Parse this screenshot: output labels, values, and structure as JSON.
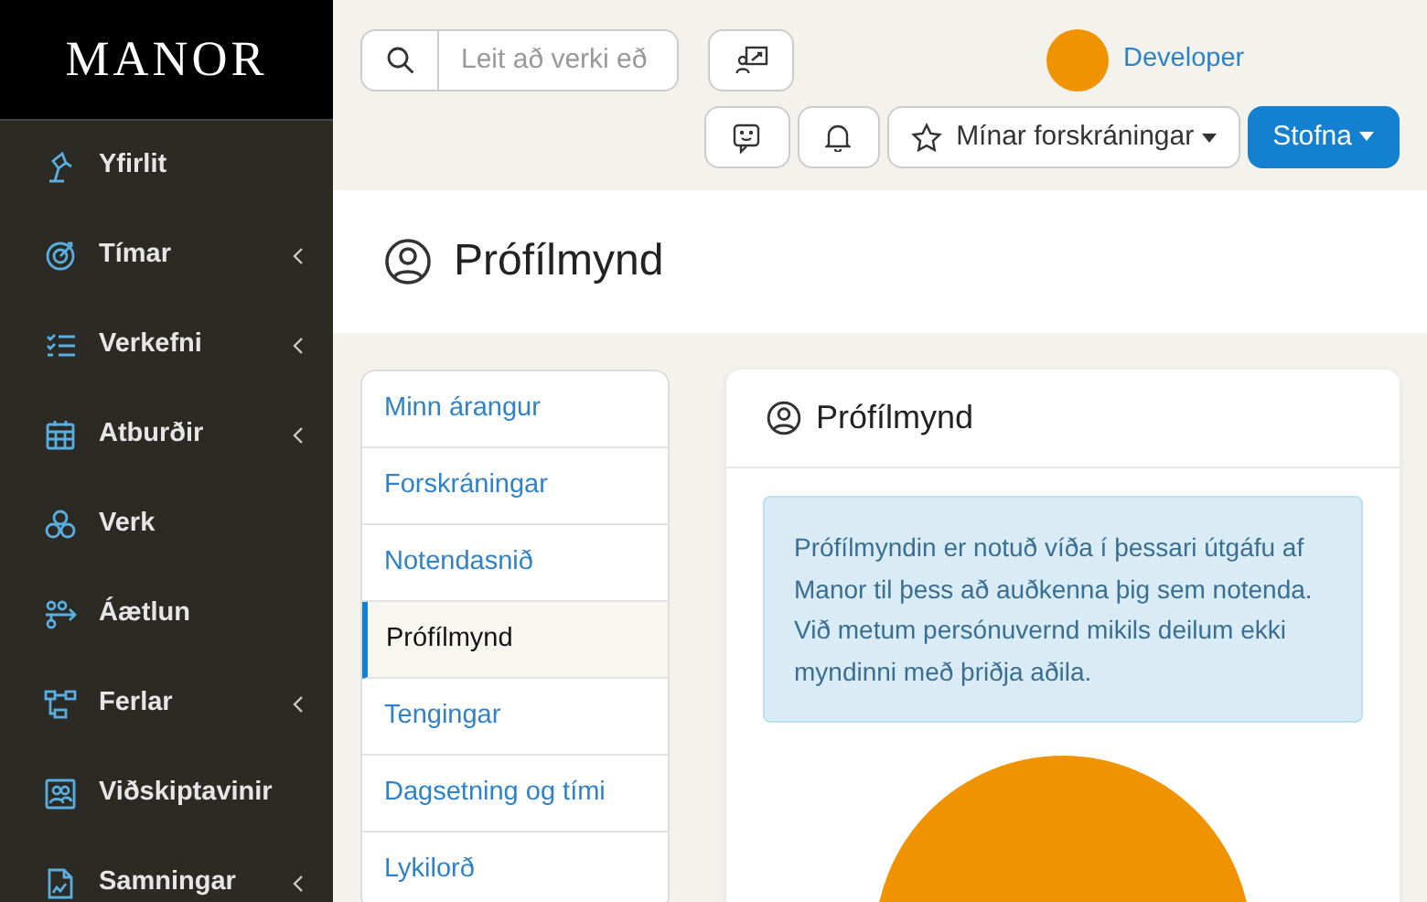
{
  "logo": "MANOR",
  "sidebar": {
    "items": [
      {
        "label": "Yfirlit",
        "expandable": false
      },
      {
        "label": "Tímar",
        "expandable": true
      },
      {
        "label": "Verkefni",
        "expandable": true
      },
      {
        "label": "Atburðir",
        "expandable": true
      },
      {
        "label": "Verk",
        "expandable": false
      },
      {
        "label": "Áætlun",
        "expandable": false
      },
      {
        "label": "Ferlar",
        "expandable": true
      },
      {
        "label": "Viðskiptavinir",
        "expandable": false
      },
      {
        "label": "Samningar",
        "expandable": true
      }
    ]
  },
  "search": {
    "placeholder": "Leit að verki eð"
  },
  "user": {
    "name": "Developer"
  },
  "toolbar": {
    "favorites": "Mínar forskráningar",
    "create": "Stofna"
  },
  "page_title": "Prófílmynd",
  "settings_menu": [
    {
      "label": "Minn árangur",
      "selected": false
    },
    {
      "label": "Forskráningar",
      "selected": false
    },
    {
      "label": "Notendasnið",
      "selected": false
    },
    {
      "label": "Prófílmynd",
      "selected": true
    },
    {
      "label": "Tengingar",
      "selected": false
    },
    {
      "label": "Dagsetning og tími",
      "selected": false
    },
    {
      "label": "Lykilorð",
      "selected": false
    }
  ],
  "card": {
    "title": "Prófílmynd",
    "info": "Prófílmyndin er notuð víða í þessari útgáfu af Manor til þess að auðkenna þig sem notenda. Við metum persónuvernd mikils deilum ekki myndinni með þriðja aðila."
  }
}
